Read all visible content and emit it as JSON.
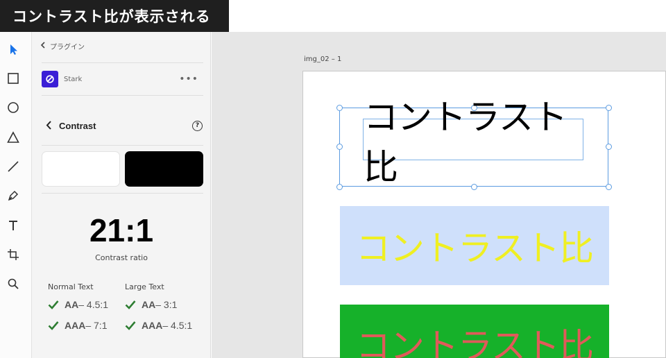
{
  "banner": {
    "text": "コントラスト比が表示される"
  },
  "toolbar": {
    "tools": [
      {
        "icon": "select-arrow-icon"
      },
      {
        "icon": "rectangle-icon"
      },
      {
        "icon": "ellipse-icon"
      },
      {
        "icon": "triangle-icon"
      },
      {
        "icon": "line-icon"
      },
      {
        "icon": "pen-icon"
      },
      {
        "icon": "text-icon"
      },
      {
        "icon": "artboard-icon"
      },
      {
        "icon": "zoom-icon"
      }
    ]
  },
  "panel": {
    "breadcrumb": "プラグイン",
    "plugin_name": "Stark",
    "more": "•••",
    "contrast_title": "Contrast",
    "help": "?",
    "foreground_color": "#ffffff",
    "background_color": "#000000",
    "ratio": "21:1",
    "ratio_label": "Contrast ratio",
    "normal_text": {
      "heading": "Normal Text",
      "aa_level": "AA",
      "aa_value": "– 4.5:1",
      "aaa_level": "AAA",
      "aaa_value": "– 7:1"
    },
    "large_text": {
      "heading": "Large Text",
      "aa_level": "AA",
      "aa_value": "– 3:1",
      "aaa_level": "AAA",
      "aaa_value": "– 4.5:1"
    },
    "pass_color": "#2e7d32"
  },
  "canvas": {
    "artboard_label": "img_02 – 1",
    "samples": [
      {
        "text": "コントラスト比",
        "text_color": "#000000",
        "background": "#ffffff"
      },
      {
        "text": "コントラスト比",
        "text_color": "#efef22",
        "background": "#cfe0fb"
      },
      {
        "text": "コントラスト比",
        "text_color": "#e05a5a",
        "background": "#16b12a"
      }
    ]
  }
}
